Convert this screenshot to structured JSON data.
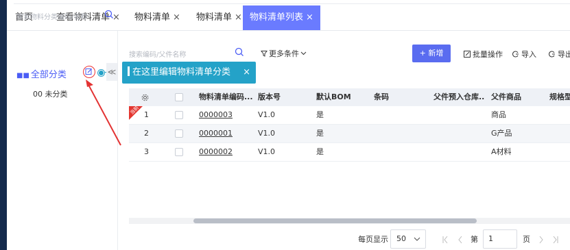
{
  "tabs": [
    {
      "label": "首页",
      "closable": false
    },
    {
      "label": "查看物料清单",
      "closable": true
    },
    {
      "label": "物料清单",
      "closable": true
    },
    {
      "label": "物料清单",
      "closable": true
    },
    {
      "label": "物料清单列表",
      "closable": true,
      "active": true
    }
  ],
  "close_glyph": "×",
  "sidebar": {
    "search_placeholder": "搜索物料分类编码/名称",
    "all_label": "全部分类",
    "grid_glyph": "■■",
    "uncategorized": "00 未分类",
    "collapse_glyph": "≪"
  },
  "tooltip": {
    "text": "在这里编辑物料清单分类",
    "close": "×"
  },
  "toolbar": {
    "search_placeholder": "搜索编码/父件名称",
    "more_conditions": "更多条件",
    "add_label": "+ 新增",
    "batch_label": "批量操作",
    "import_label": "导入",
    "export_label": "导出"
  },
  "table": {
    "columns": [
      "物料清单编码...",
      "版本号",
      "默认BOM",
      "条码",
      "父件预入仓库...",
      "父件商品",
      "规格型"
    ],
    "rows": [
      {
        "index": "1",
        "code": "0000003",
        "version": "V1.0",
        "default": "是",
        "barcode": "",
        "warehouse": "",
        "product": "商品",
        "spec": ""
      },
      {
        "index": "2",
        "code": "0000001",
        "version": "V1.0",
        "default": "是",
        "barcode": "",
        "warehouse": "",
        "product": "G产品",
        "spec": ""
      },
      {
        "index": "3",
        "code": "0000002",
        "version": "V1.0",
        "default": "是",
        "barcode": "",
        "warehouse": "",
        "product": "A材料",
        "spec": ""
      }
    ],
    "ribbon_text": "当前"
  },
  "pagination": {
    "per_page_label": "每页显示",
    "per_page": "50",
    "page_prefix": "第",
    "current_page": "1",
    "page_suffix": "页"
  },
  "colors": {
    "accent": "#6a7bff",
    "primary_button": "#5a6cf0",
    "tooltip": "#24a2c8",
    "annotation": "#e33333"
  }
}
